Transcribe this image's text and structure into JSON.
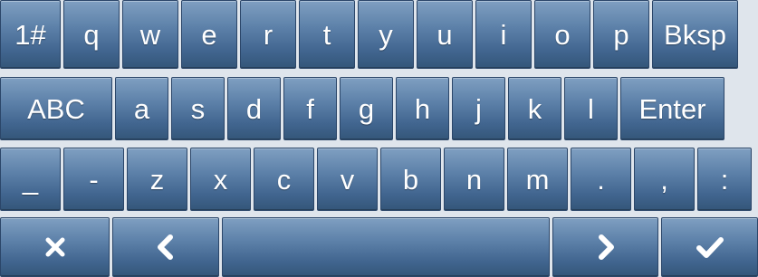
{
  "keyboard": {
    "row1": [
      "1#",
      "q",
      "w",
      "e",
      "r",
      "t",
      "y",
      "u",
      "i",
      "o",
      "p",
      "Bksp"
    ],
    "row2": [
      "ABC",
      "a",
      "s",
      "d",
      "f",
      "g",
      "h",
      "j",
      "k",
      "l",
      "Enter"
    ],
    "row3": [
      "_",
      "-",
      "z",
      "x",
      "c",
      "v",
      "b",
      "n",
      "m",
      ".",
      ",",
      ":"
    ],
    "row4_icons": {
      "clear": "close-icon",
      "left": "chevron-left-icon",
      "space": "",
      "right": "chevron-right-icon",
      "done": "checkmark-icon"
    }
  },
  "colors": {
    "key_top": "#7f9fc1",
    "key_bottom": "#345679",
    "key_text": "#ffffff",
    "key_border": "#2b4669"
  }
}
